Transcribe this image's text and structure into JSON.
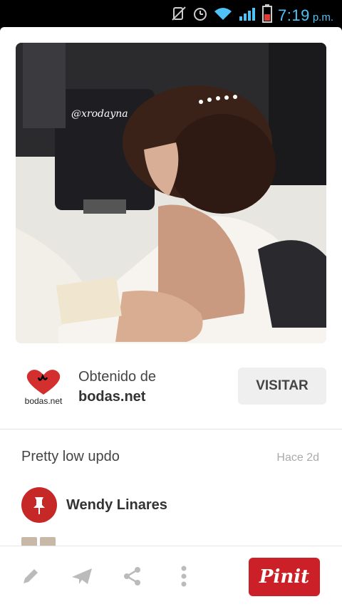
{
  "status_bar": {
    "time": "7:19",
    "ampm": "p.m."
  },
  "pin": {
    "image_watermark": "@xrodayna",
    "source_label": "Obtenido de",
    "source_site": "bodas.net",
    "source_logo_text": "bodas.net",
    "visit_button": "VISITAR",
    "description": "Pretty low updo",
    "timestamp": "Hace 2d",
    "pinner_name": "Wendy Linares"
  },
  "toolbar": {
    "pinit_label": "Pinit",
    "icons": [
      "edit-icon",
      "send-icon",
      "share-icon",
      "more-icon"
    ]
  },
  "colors": {
    "brand_red": "#cb2027",
    "status_time": "#4fc3f7"
  }
}
